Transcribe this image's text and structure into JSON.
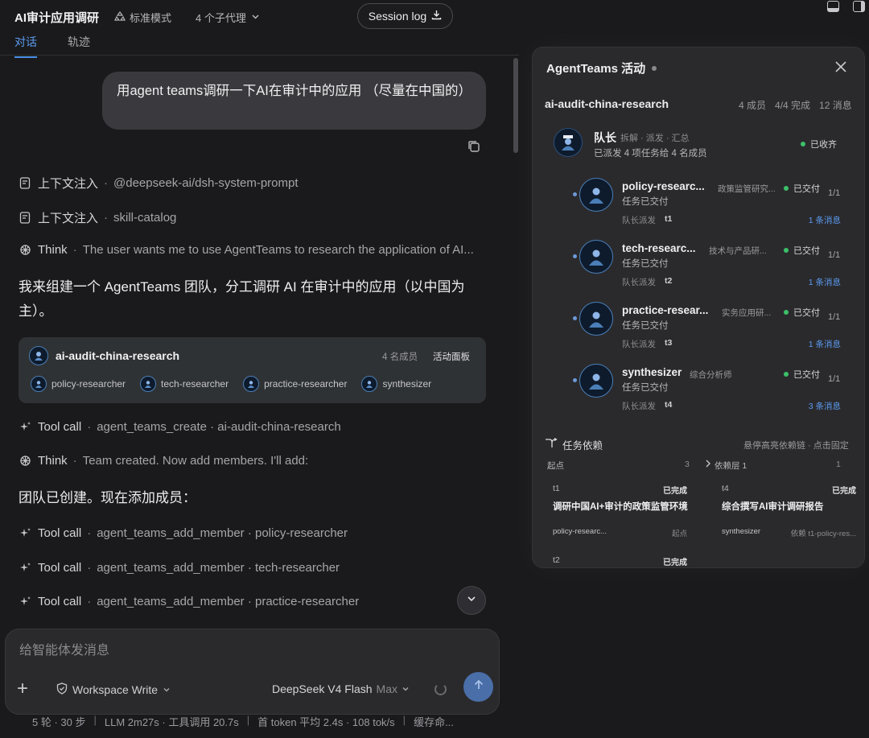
{
  "app": {
    "title": "AI审计应用调研",
    "mode": "标准模式",
    "agents": "4 个子代理",
    "session_log": "Session log"
  },
  "tabs": [
    "对话",
    "轨迹"
  ],
  "chat": {
    "user_message": "用agent teams调研一下AI在审计中的应用 （尽量在中国的）",
    "rows": [
      {
        "label": "上下文注入",
        "text": "@deepseek-ai/dsh-system-prompt"
      },
      {
        "label": "上下文注入",
        "text": "skill-catalog"
      },
      {
        "label": "Think",
        "text": "The user wants me to use AgentTeams to research the application of AI..."
      }
    ],
    "para1": "我来组建一个 AgentTeams 团队，分工调研 AI 在审计中的应用（以中国为主）。",
    "team_card": {
      "name": "ai-audit-china-research",
      "count": "4 名成员",
      "panel_link": "活动面板",
      "members": [
        "policy-researcher",
        "tech-researcher",
        "practice-researcher",
        "synthesizer"
      ]
    },
    "rows2": [
      {
        "label": "Tool call",
        "text": "agent_teams_create · ai-audit-china-research"
      },
      {
        "label": "Think",
        "text": "Team created. Now add members. I'll add:"
      }
    ],
    "para2": "团队已创建。现在添加成员：",
    "rows3": [
      {
        "label": "Tool call",
        "text": "agent_teams_add_member · policy-researcher"
      },
      {
        "label": "Tool call",
        "text": "agent_teams_add_member · tech-researcher"
      },
      {
        "label": "Tool call",
        "text": "agent_teams_add_member · practice-researcher"
      }
    ]
  },
  "composer": {
    "placeholder": "给智能体发消息",
    "workspace": "Workspace Write",
    "model": "DeepSeek V4 Flash",
    "model_tier": "Max"
  },
  "status": [
    "5 轮 · 30 步",
    "LLM 2m27s · 工具调用 20.7s",
    "首 token 平均 2.4s · 108 tok/s",
    "缓存命..."
  ],
  "panel": {
    "title": "AgentTeams 活动",
    "team": "ai-audit-china-research",
    "stats": [
      "4 成员",
      "4/4 完成",
      "12 消息"
    ],
    "leader": {
      "name": "队长",
      "role": "拆解 · 派发 · 汇总",
      "sub": "已派发 4 项任务给 4 名成员",
      "status": "已收齐"
    },
    "members": [
      {
        "name": "policy-researc...",
        "role": "政策监管研究...",
        "status": "已交付",
        "frac": "1/1",
        "sub": "任务已交付",
        "from": "队长派发",
        "task": "t1",
        "msgs": "1 条消息"
      },
      {
        "name": "tech-researc...",
        "role": "技术与产品研...",
        "status": "已交付",
        "frac": "1/1",
        "sub": "任务已交付",
        "from": "队长派发",
        "task": "t2",
        "msgs": "1 条消息"
      },
      {
        "name": "practice-resear...",
        "role": "实务应用研...",
        "status": "已交付",
        "frac": "1/1",
        "sub": "任务已交付",
        "from": "队长派发",
        "task": "t3",
        "msgs": "1 条消息"
      },
      {
        "name": "synthesizer",
        "role": "综合分析师",
        "status": "已交付",
        "frac": "1/1",
        "sub": "任务已交付",
        "from": "队长派发",
        "task": "t4",
        "msgs": "3 条消息"
      }
    ],
    "deps": {
      "title": "任务依赖",
      "hint": "悬停高亮依赖链 · 点击固定",
      "col1": {
        "label": "起点",
        "count": "3"
      },
      "col2": {
        "label": "依赖层 1",
        "count": "1"
      },
      "cards": [
        {
          "id": "t1",
          "status": "已完成",
          "title": "调研中国AI+审计的政策监管环境",
          "who": "policy-researc...",
          "dep": "起点"
        },
        {
          "id": "t4",
          "status": "已完成",
          "title": "综合撰写AI审计调研报告",
          "who": "synthesizer",
          "dep": "依赖 t1-policy-res..."
        },
        {
          "id": "t2",
          "status": "已完成",
          "title": "",
          "who": "",
          "dep": ""
        }
      ]
    }
  },
  "icons": {
    "mode": "recycle-icon",
    "agents": "chevron-down-icon",
    "session": "download-icon",
    "copy": "copy-icon",
    "context": "document-icon",
    "think": "openai-knot-icon",
    "tool": "sparkle-icon",
    "close": "close-icon",
    "deps": "branch-icon",
    "send": "arrow-up-icon"
  },
  "colors": {
    "accent": "#5b9bf0",
    "success": "#3cc06a",
    "send_button": "#4a6ea8"
  }
}
